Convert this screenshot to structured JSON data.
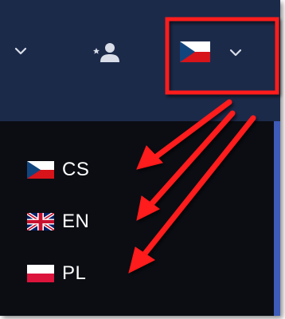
{
  "header": {
    "icons": {
      "dropdown_left": "chevron-down-icon",
      "add_user": "add-user-icon",
      "language_flag": "czech-flag",
      "language_dropdown": "chevron-down-icon"
    }
  },
  "language_menu": {
    "items": [
      {
        "code": "CS",
        "flag": "czech-flag"
      },
      {
        "code": "EN",
        "flag": "uk-flag"
      },
      {
        "code": "PL",
        "flag": "poland-flag"
      }
    ]
  },
  "colors": {
    "topbar": "#1c2a4a",
    "menu_background": "#0b0d13",
    "accent_strip": "#3e5bb8",
    "annotation_red": "#ff1a1a"
  }
}
